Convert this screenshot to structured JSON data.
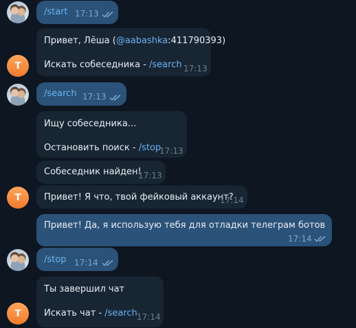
{
  "messages": [
    {
      "id": "m1",
      "text": "/start",
      "time": "17:13"
    },
    {
      "id": "m2",
      "line1_pre": "Привет, Лёша (",
      "line1_mention": "@aabashka",
      "line1_post": ":411790393)",
      "line2_pre": "Искать собеседника - ",
      "line2_cmd": "/search",
      "time": "17:13"
    },
    {
      "id": "m3",
      "text": "/search",
      "time": "17:13"
    },
    {
      "id": "m4",
      "line1": "Ищу собеседника...",
      "line2_pre": "Остановить поиск - ",
      "line2_cmd": "/stop",
      "time": "17:13"
    },
    {
      "id": "m5",
      "text": "Собеседник найден!",
      "time": "17:13"
    },
    {
      "id": "m6",
      "text": "Привет! Я что, твой фейковый аккаунт?",
      "time": "17:14"
    },
    {
      "id": "m7",
      "text": "Привет! Да, я использую тебя для отладки телеграм ботов",
      "time": "17:14"
    },
    {
      "id": "m8",
      "text": "/stop",
      "time": "17:14"
    },
    {
      "id": "m9",
      "line1": "Ты завершил чат",
      "line2_pre": "Искать чат - ",
      "line2_cmd": "/search",
      "time": "17:14"
    }
  ],
  "bot_avatar_letter": "T",
  "colors": {
    "background": "#0e1621",
    "incoming": "#182533",
    "outgoing": "#2b5278",
    "link": "#6ab3f3"
  }
}
